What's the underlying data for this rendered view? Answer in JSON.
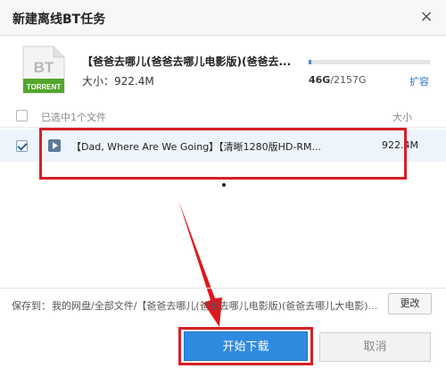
{
  "dialog": {
    "title": "新建离线BT任务",
    "close_glyph": "×"
  },
  "torrent": {
    "icon_text_top": "BT",
    "icon_text_bottom": "TORRENT",
    "name": "【爸爸去哪儿(爸爸去哪儿电影版)(爸爸去...",
    "size": "大小：922.4M"
  },
  "storage": {
    "used_fraction": 0.021,
    "used": "46G",
    "total": "/2157G",
    "expand_label": "扩容"
  },
  "file_list": {
    "header_selected": "已选中1个文件",
    "header_size": "大小",
    "rows": [
      {
        "name": "【Dad, Where Are We Going】【清晰1280版HD-RM...",
        "size": "922.4M",
        "checked": true
      }
    ]
  },
  "save": {
    "label": "保存到：",
    "path": "我的网盘/全部文件/【爸爸去哪儿(爸爸去哪儿电影版)(爸爸去哪儿大电影)...",
    "change_label": "更改"
  },
  "actions": {
    "start_label": "开始下载",
    "cancel_label": "取消"
  },
  "colors": {
    "accent": "#2f8bde",
    "annotation_red": "#d81f26",
    "torrent_green": "#53a72c"
  }
}
